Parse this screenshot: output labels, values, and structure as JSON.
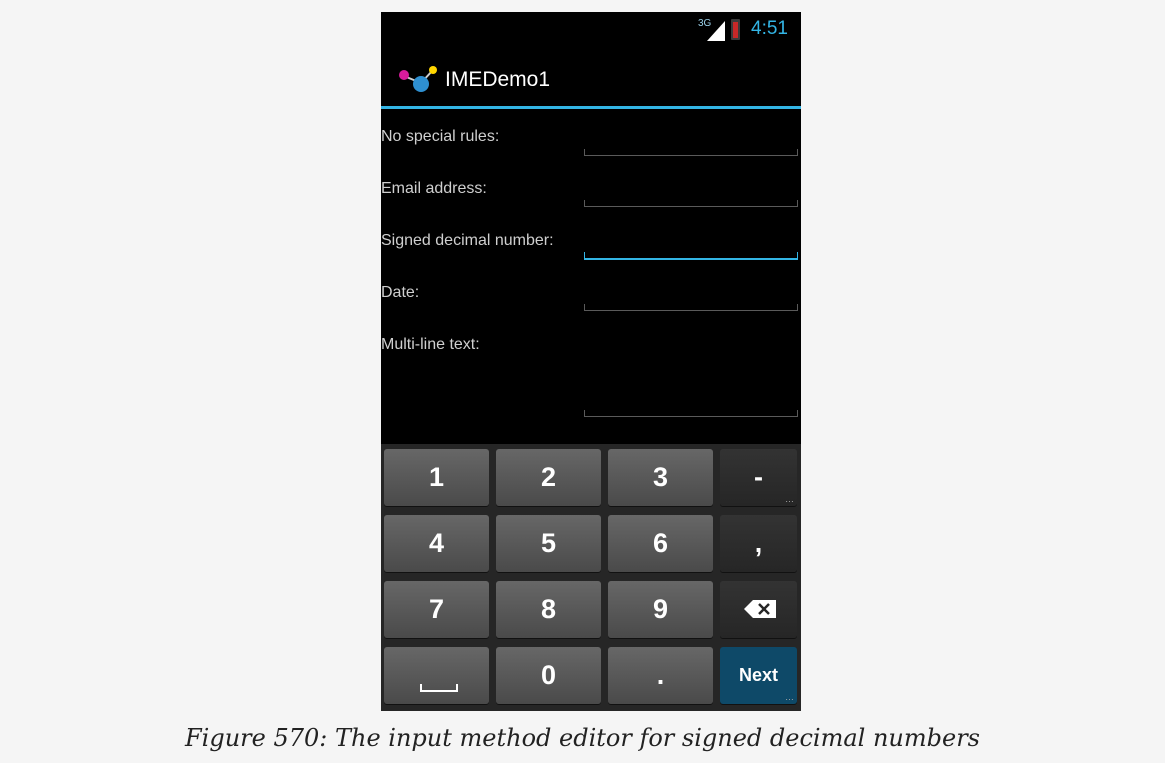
{
  "status_bar": {
    "network": "3G",
    "time": "4:51",
    "accent_color": "#33b5e5",
    "battery_color": "#c62828"
  },
  "action_bar": {
    "app_icon": "molecule-app-icon",
    "title": "IMEDemo1"
  },
  "form": {
    "fields": [
      {
        "label": "No special rules:",
        "value": ""
      },
      {
        "label": "Email address:",
        "value": ""
      },
      {
        "label": "Signed decimal number:",
        "value": "",
        "focused": true
      },
      {
        "label": "Date:",
        "value": ""
      },
      {
        "label": "Multi-line text:",
        "value": ""
      }
    ]
  },
  "keyboard": {
    "rows": [
      [
        "1",
        "2",
        "3",
        "-"
      ],
      [
        "4",
        "5",
        "6",
        ","
      ],
      [
        "7",
        "8",
        "9",
        "backspace-icon"
      ],
      [
        "space-icon",
        "0",
        ".",
        "Next"
      ]
    ],
    "enter_label": "Next",
    "enter_color": "#0e4968"
  },
  "caption": "Figure 570: The input method editor for signed decimal numbers"
}
